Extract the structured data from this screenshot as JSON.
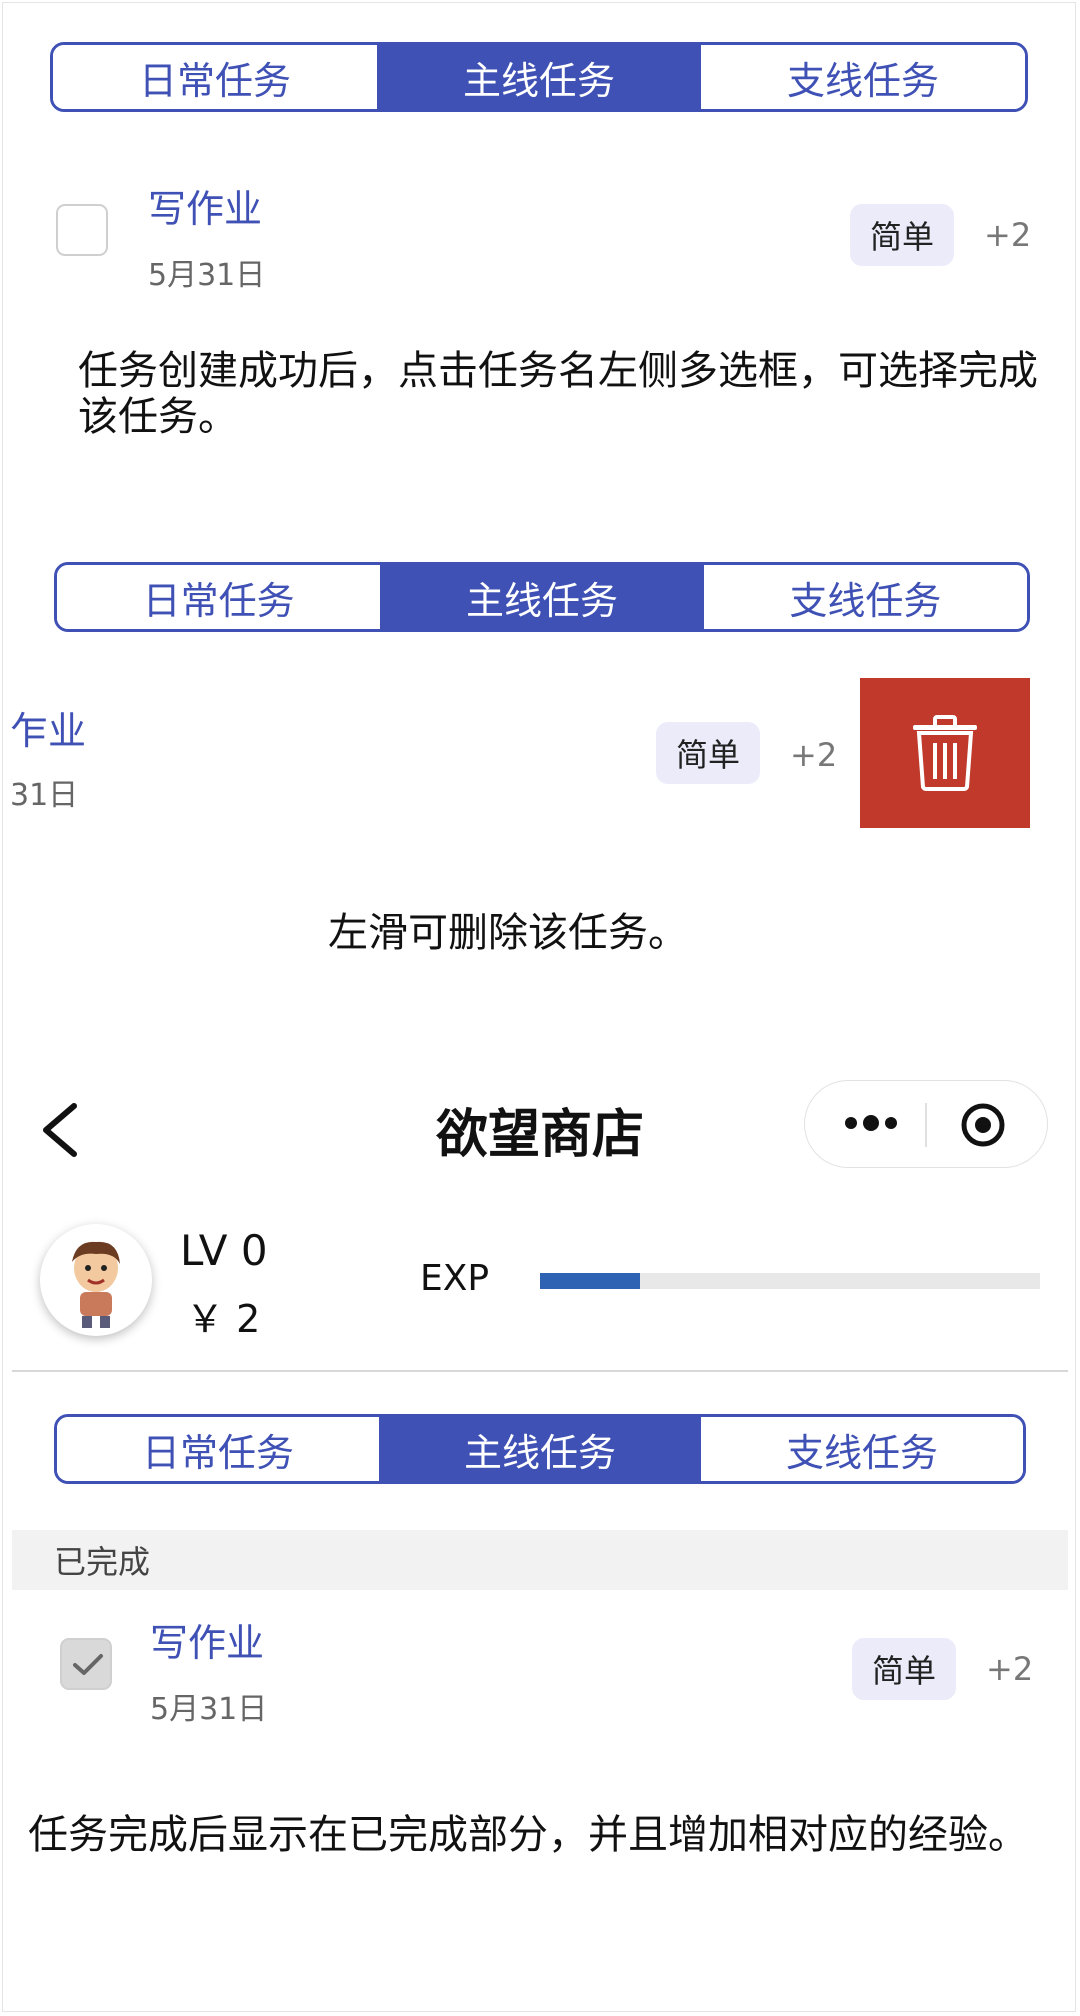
{
  "tabs": [
    "日常任务",
    "主线任务",
    "支线任务"
  ],
  "task": {
    "title": "写作业",
    "date": "5月31日",
    "difficulty": "简单",
    "points": "+2"
  },
  "swiped_task": {
    "title_visible": "乍业",
    "date_visible": "31日"
  },
  "captions": {
    "complete_hint": "任务创建成功后，点击任务名左侧多选框，可选择完成该任务。",
    "delete_hint": "左滑可删除该任务。",
    "completed_hint": "任务完成后显示在已完成部分，并且增加相对应的经验。"
  },
  "navbar": {
    "title": "欲望商店"
  },
  "profile": {
    "level": "LV 0",
    "money": "￥ 2",
    "exp_label": "EXP",
    "exp_progress": 0.2
  },
  "completed_section": {
    "label": "已完成"
  },
  "colors": {
    "accent": "#3f51b5",
    "delete": "#c0392b",
    "exp_bar": "#2d63b2",
    "badge_bg": "#ebebfa"
  },
  "icons": {
    "delete": "trash-icon",
    "back": "back-chevron-icon",
    "more": "more-dots-icon",
    "close": "target-circle-icon",
    "check": "checkmark-icon"
  }
}
